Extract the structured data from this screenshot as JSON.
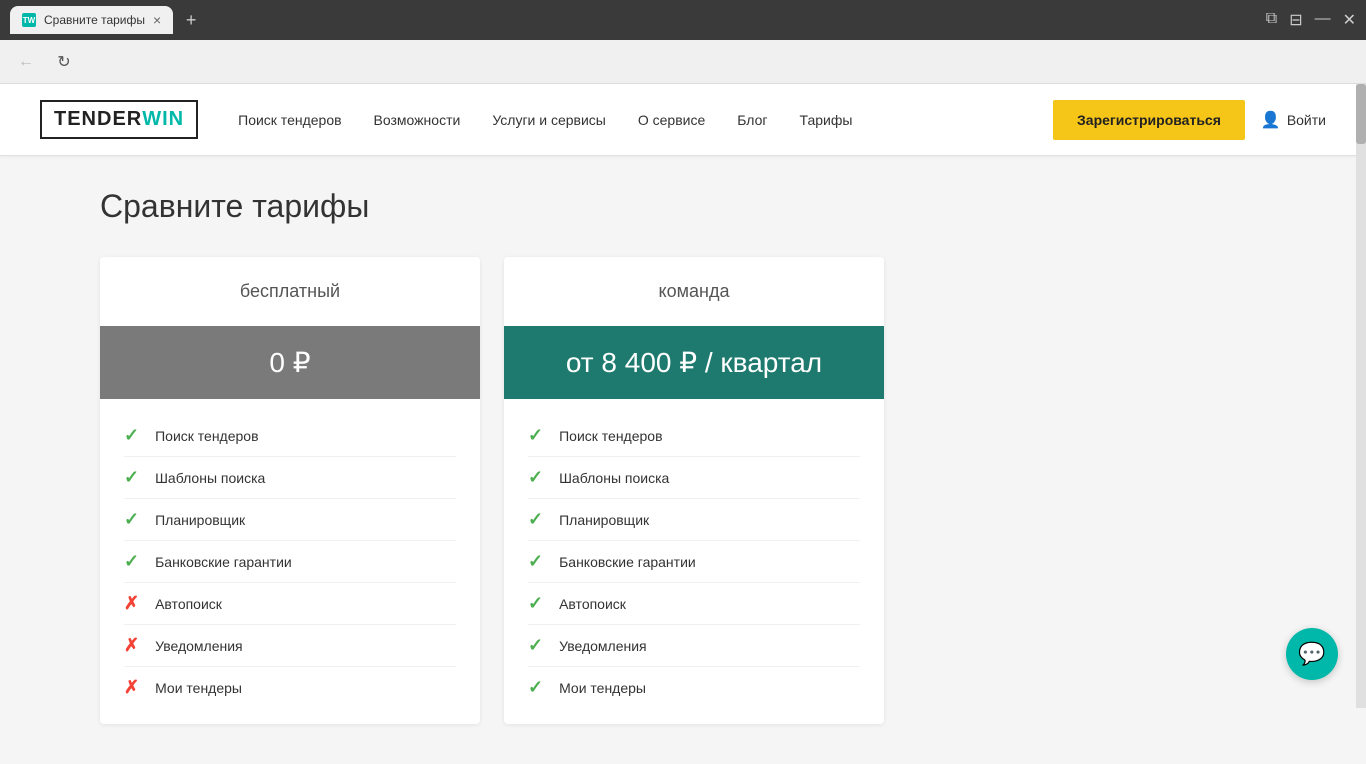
{
  "browser": {
    "tab_label": "Сравните тарифы",
    "favicon_text": "TW",
    "close_label": "×",
    "new_tab_label": "+",
    "back_label": "←",
    "refresh_label": "↻",
    "controls": [
      "⧉",
      "⊟",
      "—",
      "✕"
    ]
  },
  "header": {
    "logo_tender": "TENDER",
    "logo_win": "WIN",
    "nav_links": [
      "Поиск тендеров",
      "Возможности",
      "Услуги и сервисы",
      "О сервисе",
      "Блог",
      "Тарифы"
    ],
    "register_btn": "Зарегистрироваться",
    "login_btn": "Войти"
  },
  "page": {
    "title": "Сравните тарифы",
    "plans": [
      {
        "name": "бесплатный",
        "price": "0 ₽",
        "price_type": "free",
        "features": [
          {
            "name": "Поиск тендеров",
            "available": true
          },
          {
            "name": "Шаблоны поиска",
            "available": true
          },
          {
            "name": "Планировщик",
            "available": true
          },
          {
            "name": "Банковские гарантии",
            "available": true
          },
          {
            "name": "Автопоиск",
            "available": false
          },
          {
            "name": "Уведомления",
            "available": false
          },
          {
            "name": "Мои тендеры",
            "available": false
          }
        ]
      },
      {
        "name": "команда",
        "price": "от 8 400 ₽ / квартал",
        "price_type": "team",
        "features": [
          {
            "name": "Поиск тендеров",
            "available": true
          },
          {
            "name": "Шаблоны поиска",
            "available": true
          },
          {
            "name": "Планировщик",
            "available": true
          },
          {
            "name": "Банковские гарантии",
            "available": true
          },
          {
            "name": "Автопоиск",
            "available": true
          },
          {
            "name": "Уведомления",
            "available": true
          },
          {
            "name": "Мои тендеры",
            "available": true
          }
        ]
      }
    ]
  },
  "colors": {
    "accent_teal": "#00b8a9",
    "price_free_bg": "#7a7a7a",
    "price_team_bg": "#1e7a6e",
    "register_yellow": "#f5c518",
    "check_green": "#4caf50",
    "cross_red": "#f44336"
  }
}
